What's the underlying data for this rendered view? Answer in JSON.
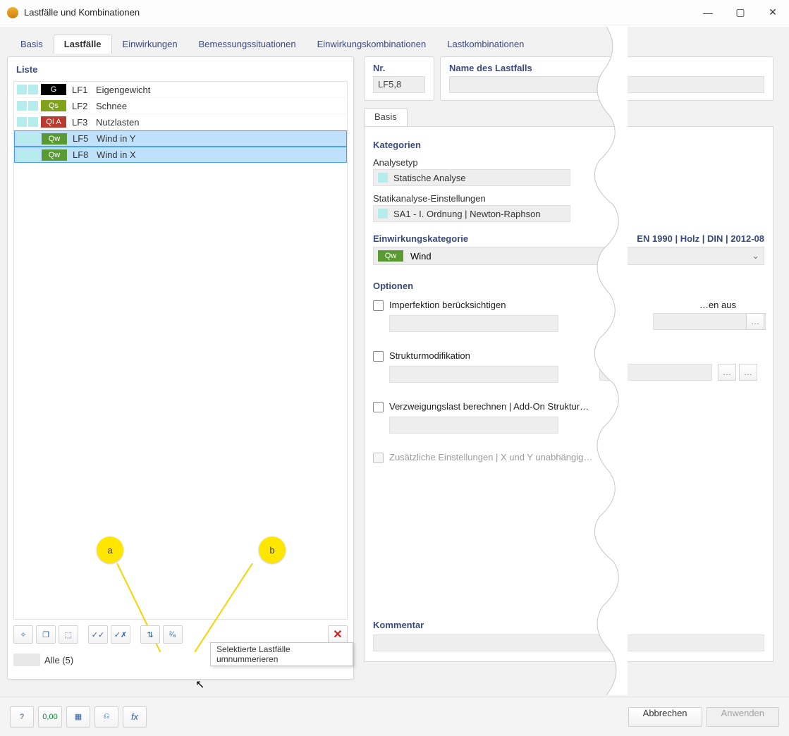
{
  "window": {
    "title": "Lastfälle und Kombinationen"
  },
  "tabs": [
    "Basis",
    "Lastfälle",
    "Einwirkungen",
    "Bemessungssituationen",
    "Einwirkungskombinationen",
    "Lastkombinationen"
  ],
  "active_tab": 1,
  "list": {
    "title": "Liste",
    "rows": [
      {
        "tag": "G",
        "tagClass": "tagG",
        "id": "LF1",
        "name": "Eigengewicht",
        "sel": false
      },
      {
        "tag": "Qs",
        "tagClass": "tagQs",
        "id": "LF2",
        "name": "Schnee",
        "sel": false
      },
      {
        "tag": "QI A",
        "tagClass": "tagQI",
        "id": "LF3",
        "name": "Nutzlasten",
        "sel": false
      },
      {
        "tag": "Qw",
        "tagClass": "tagQw",
        "id": "LF5",
        "name": "Wind in Y",
        "sel": true
      },
      {
        "tag": "Qw",
        "tagClass": "tagQw",
        "id": "LF8",
        "name": "Wind in X",
        "sel": true
      }
    ],
    "filter": "Alle (5)",
    "tooltip": "Selektierte Lastfälle umnummerieren"
  },
  "balloons": {
    "a": "a",
    "b": "b"
  },
  "right": {
    "nr_label": "Nr.",
    "nr_value": "LF5,8",
    "name_label": "Name des Lastfalls",
    "name_value": "",
    "subtab": "Basis",
    "sect_kat": "Kategorien",
    "analysetyp_label": "Analysetyp",
    "analysetyp_value": "Statische Analyse",
    "statik_label": "Statikanalyse-Einstellungen",
    "statik_value": "SA1 - I. Ordnung | Newton-Raphson",
    "einwkat_label": "Einwirkungskategorie",
    "standard": "EN 1990 | Holz | DIN | 2012-08",
    "einwkat_tag": "Qw",
    "einwkat_value": "Wind",
    "sect_opt": "Optionen",
    "opt1": "Imperfektion berücksichtigen",
    "opt1r": "…en aus",
    "opt2": "Strukturmodifikation",
    "opt3": "Verzweigungslast berechnen | Add-On Struktur…",
    "opt4": "Zusätzliche Einstellungen | X und Y unabhängig…",
    "comment_label": "Kommentar"
  },
  "dlg": {
    "abbrechen": "Abbrechen",
    "anwenden": "Anwenden"
  }
}
